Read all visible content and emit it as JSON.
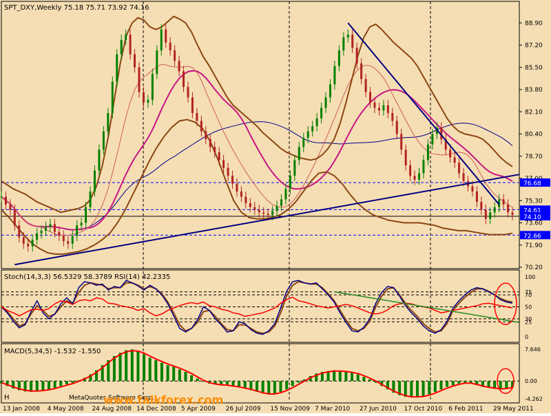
{
  "colors": {
    "background": "#f5deb3",
    "axis_bg": "#ffffff",
    "grid": "#000000",
    "bull_candle": "#008000",
    "bear_candle": "#b22222",
    "bollinger": "#8b4513",
    "ma_long": "#00008b",
    "ma_mid": "#c71585",
    "trendline": "#000080",
    "stoch_main": "#00008b",
    "stoch_signal": "#8b4513",
    "rsi": "#ff0000",
    "macd_hist": "#008000",
    "macd_signal": "#ff0000",
    "annotation_circle": "#ff0000",
    "hline": "#0000ff",
    "highlight_box": "#0000ff"
  },
  "price_panel": {
    "header": "SPT_DXY,Weekly  75.18 75.71 73.92 74.16",
    "price_labels": [
      "88.90",
      "87.20",
      "85.50",
      "83.80",
      "82.10",
      "80.40",
      "78.70",
      "77.00",
      "75.30",
      "73.60",
      "71.90",
      "70.20"
    ],
    "highlighted_labels": [
      "76.68",
      "74.61",
      "74.10",
      "72.66"
    ]
  },
  "stoch_panel": {
    "header": "Stoch(14,3,3) 56.5329 58.3789  RSI(14) 42.2335",
    "levels": [
      "100",
      "75",
      "70",
      "50",
      "30",
      "25",
      "0"
    ]
  },
  "macd_panel": {
    "header": "MACD(5,34,5) -1.532 -1.550",
    "levels": [
      "7.646",
      "0.00",
      "-4.262"
    ]
  },
  "watermark": {
    "left_text": "H",
    "middle_text": "MetaQuotes Software Corp.",
    "brand_text": "www.talkforex.com"
  },
  "chart_data": {
    "type": "line",
    "title": "SPT_DXY,Weekly",
    "ohlc_last": {
      "open": 75.18,
      "high": 75.71,
      "low": 73.92,
      "close": 74.16
    },
    "x_labels": [
      "13 Jan 2008",
      "4 May 2008",
      "24 Aug 2008",
      "14 Dec 2008",
      "5 Apr 2009",
      "26 Jul 2009",
      "15 Nov 2009",
      "7 Mar 2010",
      "27 Jun 2010",
      "17 Oct 2010",
      "6 Feb 2011",
      "29 May 2011"
    ],
    "ylim": [
      70.2,
      89.6
    ],
    "close_series": [
      75.6,
      75.0,
      74.6,
      73.4,
      72.5,
      72.0,
      71.8,
      72.3,
      72.8,
      73.0,
      73.3,
      73.5,
      72.9,
      72.6,
      72.2,
      72.0,
      72.6,
      73.4,
      73.6,
      74.8,
      76.0,
      77.6,
      79.2,
      80.6,
      82.0,
      84.4,
      86.5,
      87.6,
      88.0,
      86.5,
      85.5,
      83.6,
      82.8,
      83.0,
      85.0,
      86.8,
      88.4,
      87.4,
      86.8,
      86.0,
      85.2,
      84.0,
      83.2,
      82.0,
      81.4,
      80.6,
      80.0,
      79.4,
      79.0,
      78.4,
      77.8,
      77.2,
      76.6,
      76.0,
      75.6,
      75.1,
      74.8,
      74.6,
      74.4,
      74.3,
      74.2,
      74.5,
      74.9,
      75.4,
      76.2,
      77.2,
      78.4,
      79.4,
      80.1,
      80.6,
      81.0,
      81.6,
      82.4,
      83.2,
      84.2,
      85.6,
      86.8,
      87.8,
      88.0,
      87.0,
      85.8,
      84.6,
      83.6,
      82.8,
      82.4,
      82.2,
      82.6,
      82.0,
      81.4,
      80.4,
      79.2,
      78.0,
      77.2,
      76.9,
      77.4,
      78.4,
      79.6,
      80.4,
      80.9,
      80.0,
      79.2,
      78.6,
      78.2,
      77.4,
      76.8,
      76.4,
      76.0,
      75.2,
      74.6,
      73.9,
      74.4,
      74.8,
      75.4,
      75.0,
      74.4,
      74.2
    ],
    "bollinger_upper": [
      76.8,
      76.5,
      76.2,
      76.0,
      75.8,
      75.5,
      75.2,
      75.0,
      74.8,
      74.6,
      74.4,
      74.5,
      74.6,
      74.7,
      74.9,
      75.4,
      76.4,
      78.0,
      80.2,
      83.0,
      85.8,
      87.9,
      88.9,
      89.3,
      89.1,
      88.6,
      88.4,
      88.6,
      89.0,
      89.4,
      89.2,
      88.9,
      88.2,
      87.2,
      86.3,
      85.6,
      84.8,
      84.0,
      83.2,
      82.6,
      82.2,
      81.8,
      81.4,
      81.0,
      80.5,
      80.1,
      79.7,
      79.3,
      79.0,
      78.8,
      78.6,
      78.5,
      78.4,
      78.5,
      78.8,
      79.3,
      80.0,
      81.2,
      82.8,
      84.6,
      86.4,
      87.8,
      88.6,
      88.8,
      88.4,
      87.9,
      87.4,
      87.0,
      86.6,
      86.2,
      85.6,
      84.8,
      84.0,
      83.2,
      82.4,
      81.6,
      81.0,
      80.6,
      80.4,
      80.3,
      80.2,
      80.0,
      79.6,
      79.1,
      78.6,
      78.2,
      77.9
    ],
    "bollinger_lower": [
      74.6,
      74.0,
      73.3,
      72.6,
      72.0,
      71.6,
      71.3,
      71.2,
      71.2,
      71.3,
      71.4,
      71.6,
      71.9,
      72.3,
      72.8,
      73.6,
      74.6,
      75.8,
      77.0,
      78.2,
      79.3,
      80.2,
      80.9,
      81.4,
      81.5,
      81.3,
      80.8,
      79.8,
      78.4,
      76.8,
      75.3,
      74.4,
      74.0,
      73.9,
      73.9,
      74.0,
      74.2,
      74.6,
      75.2,
      76.0,
      76.8,
      77.4,
      77.5,
      77.2,
      76.6,
      75.8,
      75.1,
      74.6,
      74.2,
      74.0,
      73.8,
      73.7,
      73.6,
      73.6,
      73.6,
      73.5,
      73.4,
      73.2,
      73.1,
      73.0,
      73.0,
      72.9,
      72.8,
      72.7,
      72.7,
      72.7,
      72.8
    ],
    "rsi": [
      50,
      44,
      40,
      35,
      40,
      45,
      46,
      44,
      47,
      55,
      60,
      58,
      54,
      60,
      62,
      60,
      65,
      63,
      56,
      55,
      52,
      50,
      48,
      44,
      47,
      40,
      35,
      38,
      44,
      48,
      52,
      55,
      57,
      55,
      58,
      52,
      50,
      46,
      44,
      40,
      38,
      34,
      36,
      38,
      40,
      44,
      48,
      56,
      62,
      66,
      60,
      58,
      55,
      52,
      50,
      48,
      50,
      52,
      54,
      52,
      48,
      44,
      40,
      38,
      40,
      45,
      52,
      55,
      56,
      55,
      52,
      50,
      48,
      44,
      40,
      42,
      44,
      46,
      48,
      50,
      52,
      55,
      56,
      54,
      52,
      50,
      48
    ],
    "stoch_main": [
      50,
      40,
      26,
      15,
      20,
      42,
      60,
      40,
      30,
      38,
      55,
      65,
      55,
      82,
      92,
      90,
      86,
      88,
      78,
      84,
      82,
      94,
      90,
      85,
      78,
      86,
      80,
      70,
      55,
      35,
      14,
      8,
      14,
      28,
      50,
      44,
      30,
      20,
      8,
      10,
      25,
      22,
      12,
      6,
      4,
      10,
      22,
      48,
      76,
      92,
      94,
      90,
      88,
      90,
      80,
      70,
      58,
      40,
      24,
      10,
      8,
      16,
      30,
      56,
      74,
      84,
      82,
      68,
      52,
      40,
      30,
      18,
      10,
      6,
      12,
      26,
      48,
      60,
      70,
      78,
      82,
      80,
      75,
      70,
      62,
      58,
      56
    ],
    "stoch_signal": [
      52,
      42,
      30,
      18,
      22,
      38,
      52,
      44,
      34,
      38,
      50,
      60,
      56,
      74,
      86,
      90,
      88,
      86,
      80,
      82,
      82,
      90,
      90,
      86,
      80,
      84,
      80,
      72,
      58,
      40,
      20,
      10,
      14,
      24,
      42,
      44,
      34,
      22,
      12,
      10,
      20,
      20,
      14,
      8,
      6,
      8,
      18,
      40,
      68,
      86,
      92,
      90,
      88,
      88,
      82,
      72,
      60,
      44,
      28,
      14,
      10,
      14,
      26,
      50,
      68,
      80,
      82,
      70,
      56,
      44,
      34,
      22,
      14,
      8,
      10,
      22,
      44,
      56,
      66,
      74,
      80,
      80,
      76,
      70,
      64,
      60,
      58
    ],
    "macd_hist": [
      -0.6,
      -1.2,
      -1.8,
      -2.2,
      -2.5,
      -2.6,
      -2.5,
      -2.3,
      -2.0,
      -1.6,
      -1.2,
      -0.8,
      -0.4,
      0.2,
      0.8,
      1.6,
      2.6,
      3.8,
      5.0,
      6.0,
      6.8,
      7.4,
      7.6,
      7.2,
      6.4,
      5.6,
      5.0,
      4.4,
      3.8,
      3.4,
      2.8,
      2.2,
      1.4,
      0.6,
      -0.2,
      -0.6,
      -0.8,
      -1.0,
      -1.1,
      -1.3,
      -1.5,
      -1.8,
      -2.2,
      -2.6,
      -3.0,
      -3.2,
      -3.0,
      -2.6,
      -2.0,
      -1.2,
      -0.4,
      0.4,
      1.2,
      1.8,
      2.2,
      2.4,
      2.6,
      2.4,
      2.2,
      2.0,
      1.6,
      1.0,
      0.4,
      -0.4,
      -1.2,
      -2.0,
      -2.8,
      -3.4,
      -3.8,
      -3.9,
      -3.8,
      -3.6,
      -3.2,
      -2.6,
      -2.0,
      -1.4,
      -1.0,
      -0.6,
      -0.4,
      -0.6,
      -1.0,
      -1.4,
      -1.6,
      -1.8,
      -2.0,
      -1.8,
      -1.5
    ],
    "macd_signal": [
      -0.4,
      -0.9,
      -1.4,
      -1.9,
      -2.2,
      -2.4,
      -2.4,
      -2.3,
      -2.1,
      -1.8,
      -1.4,
      -1.0,
      -0.6,
      -0.1,
      0.5,
      1.2,
      2.1,
      3.2,
      4.4,
      5.5,
      6.4,
      7.0,
      7.3,
      7.2,
      6.7,
      6.0,
      5.3,
      4.7,
      4.1,
      3.6,
      3.1,
      2.5,
      1.8,
      1.0,
      0.2,
      -0.4,
      -0.7,
      -0.9,
      -1.0,
      -1.2,
      -1.4,
      -1.7,
      -2.0,
      -2.4,
      -2.8,
      -3.1,
      -3.1,
      -2.8,
      -2.3,
      -1.6,
      -0.8,
      0.0,
      0.8,
      1.4,
      1.9,
      2.2,
      2.4,
      2.4,
      2.3,
      2.1,
      1.8,
      1.3,
      0.7,
      0.0,
      -0.8,
      -1.6,
      -2.4,
      -3.0,
      -3.5,
      -3.8,
      -3.8,
      -3.7,
      -3.4,
      -2.9,
      -2.3,
      -1.7,
      -1.2,
      -0.8,
      -0.5,
      -0.5,
      -0.8,
      -1.2,
      -1.5,
      -1.7,
      -1.9,
      -1.8,
      -1.55
    ]
  }
}
